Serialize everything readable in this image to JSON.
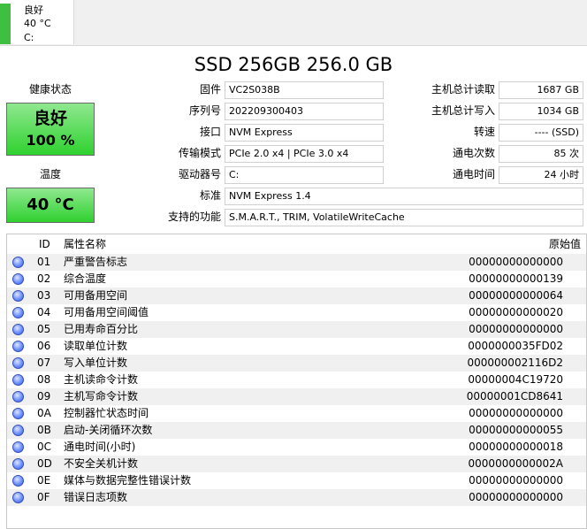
{
  "disk_tab": {
    "status": "良好",
    "temp": "40 °C",
    "drive": "C:"
  },
  "title": "SSD 256GB 256.0 GB",
  "left": {
    "health_label": "健康状态",
    "health_status": "良好",
    "health_percent": "100 %",
    "temp_label": "温度",
    "temp_value": "40 °C"
  },
  "info": {
    "firmware": {
      "label": "固件",
      "value": "VC2S038B"
    },
    "serial": {
      "label": "序列号",
      "value": "202209300403"
    },
    "interface": {
      "label": "接口",
      "value": "NVM Express"
    },
    "transfer": {
      "label": "传输模式",
      "value": "PCIe 2.0 x4 | PCIe 3.0 x4"
    },
    "drive_letter": {
      "label": "驱动器号",
      "value": "C:"
    },
    "standard": {
      "label": "标准",
      "value": "NVM Express 1.4"
    },
    "features": {
      "label": "支持的功能",
      "value": "S.M.A.R.T., TRIM, VolatileWriteCache"
    },
    "host_reads": {
      "label": "主机总计读取",
      "value": "1687 GB"
    },
    "host_writes": {
      "label": "主机总计写入",
      "value": "1034 GB"
    },
    "rpm": {
      "label": "转速",
      "value": "---- (SSD)"
    },
    "power_count": {
      "label": "通电次数",
      "value": "85 次"
    },
    "power_hours": {
      "label": "通电时间",
      "value": "24 小时"
    }
  },
  "table": {
    "headers": {
      "id": "ID",
      "name": "属性名称",
      "raw": "原始值"
    },
    "rows": [
      {
        "id": "01",
        "name": "严重警告标志",
        "raw": "00000000000000"
      },
      {
        "id": "02",
        "name": "综合温度",
        "raw": "00000000000139"
      },
      {
        "id": "03",
        "name": "可用备用空间",
        "raw": "00000000000064"
      },
      {
        "id": "04",
        "name": "可用备用空间阈值",
        "raw": "00000000000020"
      },
      {
        "id": "05",
        "name": "已用寿命百分比",
        "raw": "00000000000000"
      },
      {
        "id": "06",
        "name": "读取单位计数",
        "raw": "0000000035FD02"
      },
      {
        "id": "07",
        "name": "写入单位计数",
        "raw": "000000002116D2"
      },
      {
        "id": "08",
        "name": "主机读命令计数",
        "raw": "00000004C19720"
      },
      {
        "id": "09",
        "name": "主机写命令计数",
        "raw": "00000001CD8641"
      },
      {
        "id": "0A",
        "name": "控制器忙状态时间",
        "raw": "00000000000000"
      },
      {
        "id": "0B",
        "name": "启动-关闭循环次数",
        "raw": "00000000000055"
      },
      {
        "id": "0C",
        "name": "通电时间(小时)",
        "raw": "00000000000018"
      },
      {
        "id": "0D",
        "name": "不安全关机计数",
        "raw": "0000000000002A"
      },
      {
        "id": "0E",
        "name": "媒体与数据完整性错误计数",
        "raw": "00000000000000"
      },
      {
        "id": "0F",
        "name": "错误日志项数",
        "raw": "00000000000000"
      }
    ]
  }
}
